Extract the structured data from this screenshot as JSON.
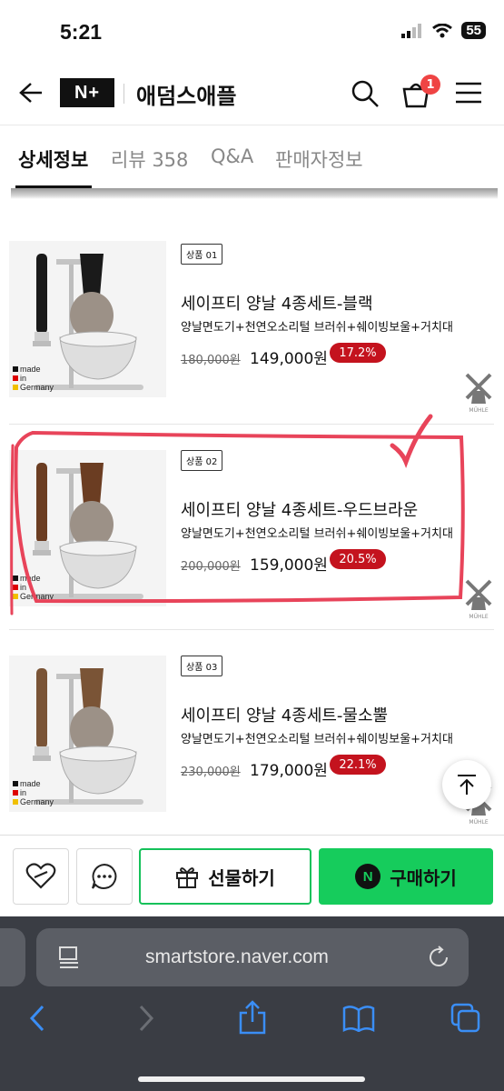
{
  "status_bar": {
    "time": "5:21",
    "battery": "55"
  },
  "header": {
    "brand": "N+",
    "store_name": "애덤스애플",
    "cart_count": "1"
  },
  "tabs": [
    {
      "label": "상세정보",
      "active": true
    },
    {
      "label": "리뷰 358",
      "active": false
    },
    {
      "label": "Q&A",
      "active": false
    },
    {
      "label": "판매자정보",
      "active": false
    }
  ],
  "products": [
    {
      "badge": "상품 01",
      "title": "세이프티 양날 4종세트-블랙",
      "desc": "양날면도기+천연오소리털 브러쉬+쉐이빙보울+거치대",
      "original_price": "180,000원",
      "price": "149,000원",
      "discount": "17.2%",
      "handle_color": "#1a1a1a"
    },
    {
      "badge": "상품 02",
      "title": "세이프티 양날 4종세트-우드브라운",
      "desc": "양날면도기+천연오소리털 브러쉬+쉐이빙보울+거치대",
      "original_price": "200,000원",
      "price": "159,000원",
      "discount": "20.5%",
      "handle_color": "#6b3d22"
    },
    {
      "badge": "상품 03",
      "title": "세이프티 양날 4종세트-물소뿔",
      "desc": "양날면도기+천연오소리털 브러쉬+쉐이빙보울+거치대",
      "original_price": "230,000원",
      "price": "179,000원",
      "discount": "22.1%",
      "handle_color": "#7a5436"
    }
  ],
  "made_label": [
    "made",
    "in",
    "Germany"
  ],
  "brand_mark": "MÜHLE",
  "actions": {
    "gift_label": "선물하기",
    "buy_label": "구매하기",
    "buy_icon_letter": "N"
  },
  "browser": {
    "url": "smartstore.naver.com"
  },
  "colors": {
    "accent_green": "#16cc5c",
    "discount_red": "#c4131e",
    "annotation_red": "#e8445a"
  }
}
